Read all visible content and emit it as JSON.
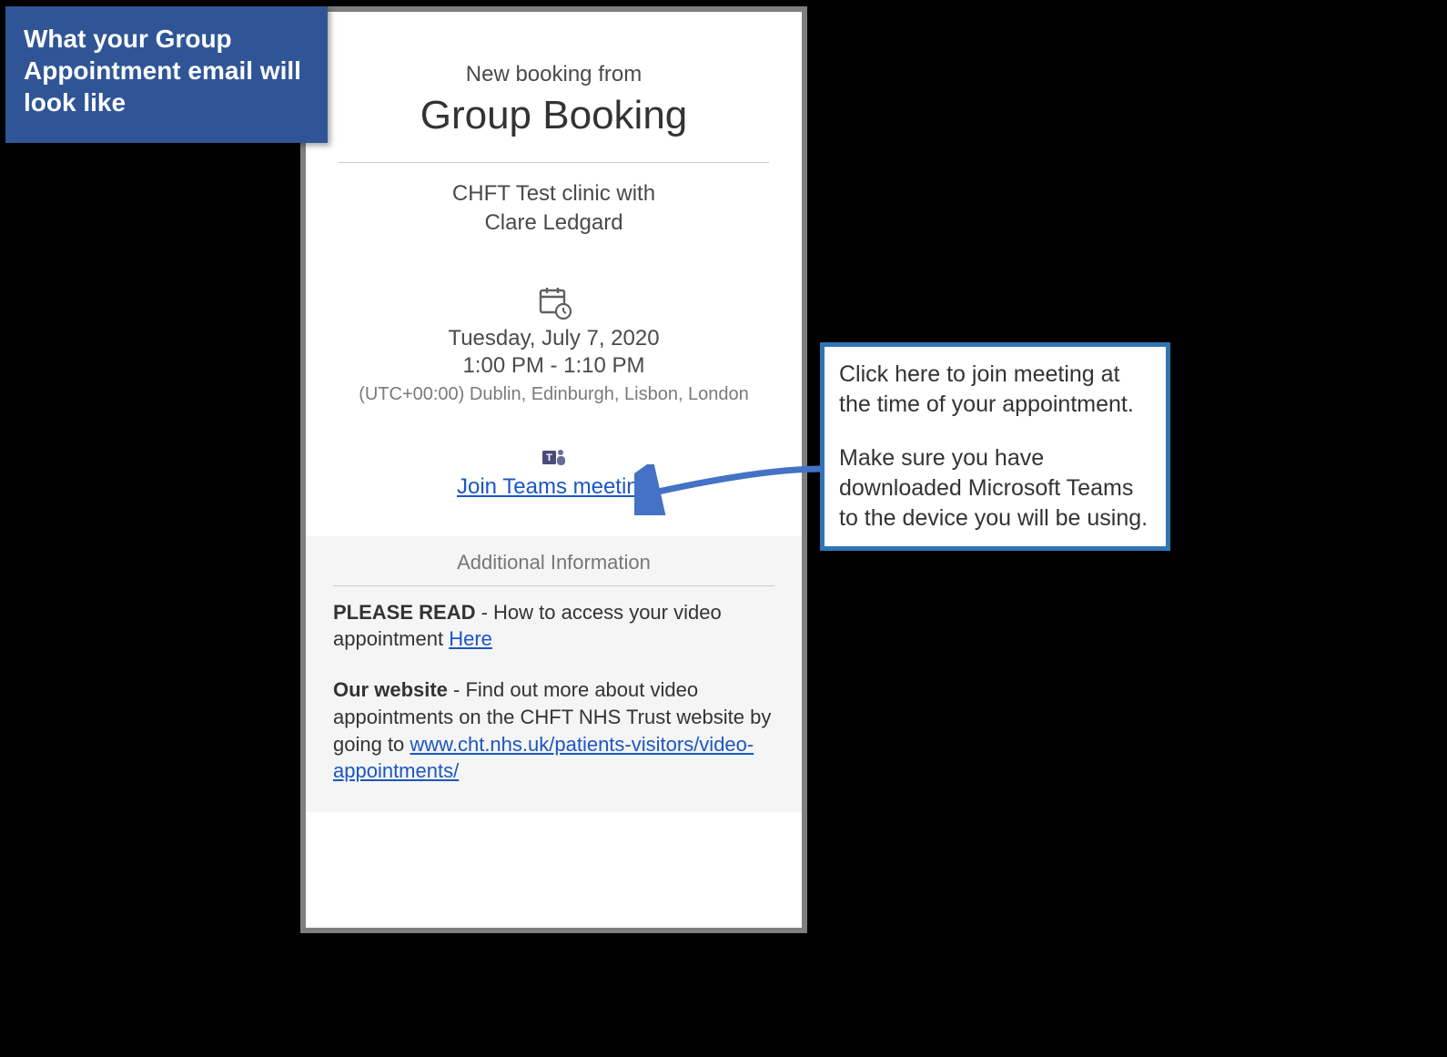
{
  "label_callout": {
    "text": "What your Group Appointment email will look like"
  },
  "email": {
    "preheader": "New booking from",
    "title": "Group Booking",
    "clinic_line1": "CHFT Test clinic with",
    "clinic_line2": "Clare Ledgard",
    "date": "Tuesday, July 7, 2020",
    "time": "1:00 PM - 1:10 PM",
    "timezone": "(UTC+00:00) Dublin, Edinburgh, Lisbon, London",
    "join_link_label": "Join Teams meeting",
    "additional": {
      "heading": "Additional Information",
      "please_read_bold": "PLEASE READ",
      "please_read_rest": " - How to access your video appointment ",
      "here_link": "Here",
      "our_website_bold": "Our website",
      "our_website_rest": " - Find out more about video appointments on the CHFT NHS Trust website by going to ",
      "website_link": "www.cht.nhs.uk/patients-visitors/video-appointments/"
    }
  },
  "instruction_callout": {
    "line1": "Click here to join meeting at the time of your appointment.",
    "line2": "Make sure you have downloaded Microsoft Teams to the device you will be using."
  }
}
